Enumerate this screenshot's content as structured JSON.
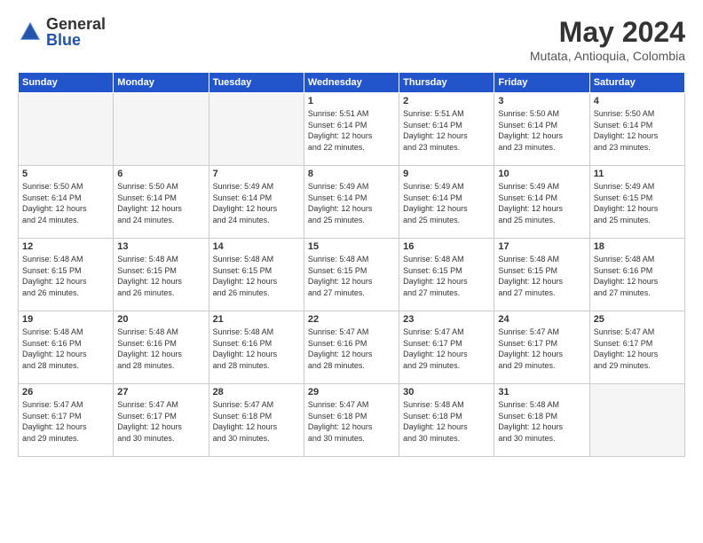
{
  "header": {
    "logo_general": "General",
    "logo_blue": "Blue",
    "month_title": "May 2024",
    "subtitle": "Mutata, Antioquia, Colombia"
  },
  "days_of_week": [
    "Sunday",
    "Monday",
    "Tuesday",
    "Wednesday",
    "Thursday",
    "Friday",
    "Saturday"
  ],
  "weeks": [
    [
      {
        "day": "",
        "info": ""
      },
      {
        "day": "",
        "info": ""
      },
      {
        "day": "",
        "info": ""
      },
      {
        "day": "1",
        "info": "Sunrise: 5:51 AM\nSunset: 6:14 PM\nDaylight: 12 hours\nand 22 minutes."
      },
      {
        "day": "2",
        "info": "Sunrise: 5:51 AM\nSunset: 6:14 PM\nDaylight: 12 hours\nand 23 minutes."
      },
      {
        "day": "3",
        "info": "Sunrise: 5:50 AM\nSunset: 6:14 PM\nDaylight: 12 hours\nand 23 minutes."
      },
      {
        "day": "4",
        "info": "Sunrise: 5:50 AM\nSunset: 6:14 PM\nDaylight: 12 hours\nand 23 minutes."
      }
    ],
    [
      {
        "day": "5",
        "info": "Sunrise: 5:50 AM\nSunset: 6:14 PM\nDaylight: 12 hours\nand 24 minutes."
      },
      {
        "day": "6",
        "info": "Sunrise: 5:50 AM\nSunset: 6:14 PM\nDaylight: 12 hours\nand 24 minutes."
      },
      {
        "day": "7",
        "info": "Sunrise: 5:49 AM\nSunset: 6:14 PM\nDaylight: 12 hours\nand 24 minutes."
      },
      {
        "day": "8",
        "info": "Sunrise: 5:49 AM\nSunset: 6:14 PM\nDaylight: 12 hours\nand 25 minutes."
      },
      {
        "day": "9",
        "info": "Sunrise: 5:49 AM\nSunset: 6:14 PM\nDaylight: 12 hours\nand 25 minutes."
      },
      {
        "day": "10",
        "info": "Sunrise: 5:49 AM\nSunset: 6:14 PM\nDaylight: 12 hours\nand 25 minutes."
      },
      {
        "day": "11",
        "info": "Sunrise: 5:49 AM\nSunset: 6:15 PM\nDaylight: 12 hours\nand 25 minutes."
      }
    ],
    [
      {
        "day": "12",
        "info": "Sunrise: 5:48 AM\nSunset: 6:15 PM\nDaylight: 12 hours\nand 26 minutes."
      },
      {
        "day": "13",
        "info": "Sunrise: 5:48 AM\nSunset: 6:15 PM\nDaylight: 12 hours\nand 26 minutes."
      },
      {
        "day": "14",
        "info": "Sunrise: 5:48 AM\nSunset: 6:15 PM\nDaylight: 12 hours\nand 26 minutes."
      },
      {
        "day": "15",
        "info": "Sunrise: 5:48 AM\nSunset: 6:15 PM\nDaylight: 12 hours\nand 27 minutes."
      },
      {
        "day": "16",
        "info": "Sunrise: 5:48 AM\nSunset: 6:15 PM\nDaylight: 12 hours\nand 27 minutes."
      },
      {
        "day": "17",
        "info": "Sunrise: 5:48 AM\nSunset: 6:15 PM\nDaylight: 12 hours\nand 27 minutes."
      },
      {
        "day": "18",
        "info": "Sunrise: 5:48 AM\nSunset: 6:16 PM\nDaylight: 12 hours\nand 27 minutes."
      }
    ],
    [
      {
        "day": "19",
        "info": "Sunrise: 5:48 AM\nSunset: 6:16 PM\nDaylight: 12 hours\nand 28 minutes."
      },
      {
        "day": "20",
        "info": "Sunrise: 5:48 AM\nSunset: 6:16 PM\nDaylight: 12 hours\nand 28 minutes."
      },
      {
        "day": "21",
        "info": "Sunrise: 5:48 AM\nSunset: 6:16 PM\nDaylight: 12 hours\nand 28 minutes."
      },
      {
        "day": "22",
        "info": "Sunrise: 5:47 AM\nSunset: 6:16 PM\nDaylight: 12 hours\nand 28 minutes."
      },
      {
        "day": "23",
        "info": "Sunrise: 5:47 AM\nSunset: 6:17 PM\nDaylight: 12 hours\nand 29 minutes."
      },
      {
        "day": "24",
        "info": "Sunrise: 5:47 AM\nSunset: 6:17 PM\nDaylight: 12 hours\nand 29 minutes."
      },
      {
        "day": "25",
        "info": "Sunrise: 5:47 AM\nSunset: 6:17 PM\nDaylight: 12 hours\nand 29 minutes."
      }
    ],
    [
      {
        "day": "26",
        "info": "Sunrise: 5:47 AM\nSunset: 6:17 PM\nDaylight: 12 hours\nand 29 minutes."
      },
      {
        "day": "27",
        "info": "Sunrise: 5:47 AM\nSunset: 6:17 PM\nDaylight: 12 hours\nand 30 minutes."
      },
      {
        "day": "28",
        "info": "Sunrise: 5:47 AM\nSunset: 6:18 PM\nDaylight: 12 hours\nand 30 minutes."
      },
      {
        "day": "29",
        "info": "Sunrise: 5:47 AM\nSunset: 6:18 PM\nDaylight: 12 hours\nand 30 minutes."
      },
      {
        "day": "30",
        "info": "Sunrise: 5:48 AM\nSunset: 6:18 PM\nDaylight: 12 hours\nand 30 minutes."
      },
      {
        "day": "31",
        "info": "Sunrise: 5:48 AM\nSunset: 6:18 PM\nDaylight: 12 hours\nand 30 minutes."
      },
      {
        "day": "",
        "info": ""
      }
    ]
  ]
}
